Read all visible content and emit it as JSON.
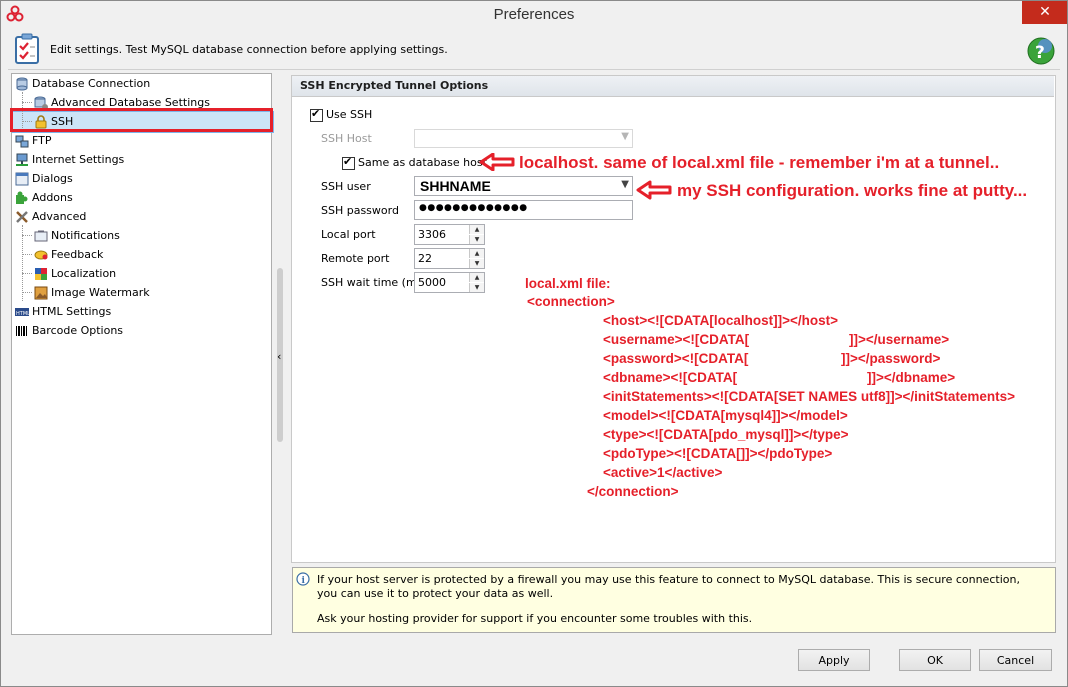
{
  "window": {
    "title": "Preferences",
    "close_glyph": "✕"
  },
  "header": {
    "text": "Edit settings. Test MySQL database connection before applying settings."
  },
  "tree": {
    "items": [
      {
        "label": "Database Connection",
        "icon": "database-icon"
      },
      {
        "label": "Advanced Database Settings",
        "icon": "database-settings-icon"
      },
      {
        "label": "SSH",
        "icon": "lock-icon",
        "selected": true
      },
      {
        "label": "FTP",
        "icon": "ftp-icon"
      },
      {
        "label": "Internet Settings",
        "icon": "network-icon"
      },
      {
        "label": "Dialogs",
        "icon": "dialog-icon"
      },
      {
        "label": "Addons",
        "icon": "puzzle-icon"
      },
      {
        "label": "Advanced",
        "icon": "tools-icon"
      },
      {
        "label": "Notifications",
        "icon": "bell-icon"
      },
      {
        "label": "Feedback",
        "icon": "feedback-icon"
      },
      {
        "label": "Localization",
        "icon": "flags-icon"
      },
      {
        "label": "Image Watermark",
        "icon": "image-icon"
      },
      {
        "label": "HTML Settings",
        "icon": "html-icon"
      },
      {
        "label": "Barcode Options",
        "icon": "barcode-icon"
      }
    ]
  },
  "ssh": {
    "group_title": "SSH Encrypted Tunnel Options",
    "use_ssh_label": "Use SSH",
    "use_ssh_checked": true,
    "ssh_host_label": "SSH Host",
    "ssh_host_value": "",
    "same_as_db_label": "Same as database host",
    "same_as_db_checked": true,
    "ssh_user_label": "SSH user",
    "ssh_user_value": "SHHNAME",
    "ssh_password_label": "SSH password",
    "ssh_password_value": "●●●●●●●●●●●●●",
    "local_port_label": "Local port",
    "local_port_value": "3306",
    "remote_port_label": "Remote port",
    "remote_port_value": "22",
    "wait_time_label": "SSH wait time (ms)",
    "wait_time_value": "5000"
  },
  "annotations": {
    "host_note": "localhost. same of local.xml file - remember i'm at a tunnel..",
    "user_note": "my SSH configuration. works fine at putty...",
    "accent_color": "#e5202a",
    "xml_lines": [
      "local.xml  file:",
      "<connection>",
      "<host><![CDATA[localhost]]></host>",
      "<username><![CDATA[",
      "]]></username>",
      "<password><![CDATA[",
      "]]></password>",
      "<dbname><![CDATA[",
      "]]></dbname>",
      "<initStatements><![CDATA[SET NAMES utf8]]></initStatements>",
      "<model><![CDATA[mysql4]]></model>",
      "<type><![CDATA[pdo_mysql]]></type>",
      "<pdoType><![CDATA[]]></pdoType>",
      "<active>1</active>",
      "</connection>"
    ]
  },
  "info": {
    "line1": "If your host server is protected by a firewall you may use this feature to connect to MySQL database. This is secure connection, you can use it to protect your data as well.",
    "line2": "Ask your hosting provider for support if you encounter some troubles with this."
  },
  "buttons": {
    "apply": "Apply",
    "ok": "OK",
    "cancel": "Cancel"
  }
}
